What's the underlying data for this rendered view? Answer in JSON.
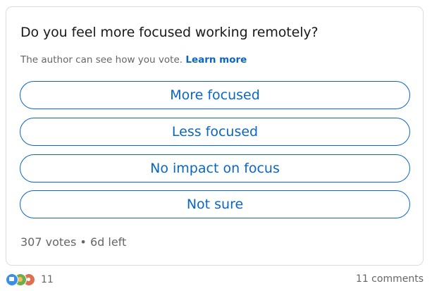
{
  "poll": {
    "question": "Do you feel more focused working remotely?",
    "visibility_text": "The author can see how you vote.",
    "learn_more_label": "Learn more",
    "options": [
      {
        "label": "More focused"
      },
      {
        "label": "Less focused"
      },
      {
        "label": "No impact on focus"
      },
      {
        "label": "Not sure"
      }
    ],
    "meta": "307 votes • 6d left"
  },
  "social": {
    "reaction_icons": [
      "like-icon",
      "celebrate-icon",
      "love-icon"
    ],
    "reaction_count": "11",
    "comments_label": "11 comments"
  },
  "colors": {
    "accent": "#0a66c2",
    "secondary_text": "#666666",
    "card_border": "#dcdcdc"
  }
}
